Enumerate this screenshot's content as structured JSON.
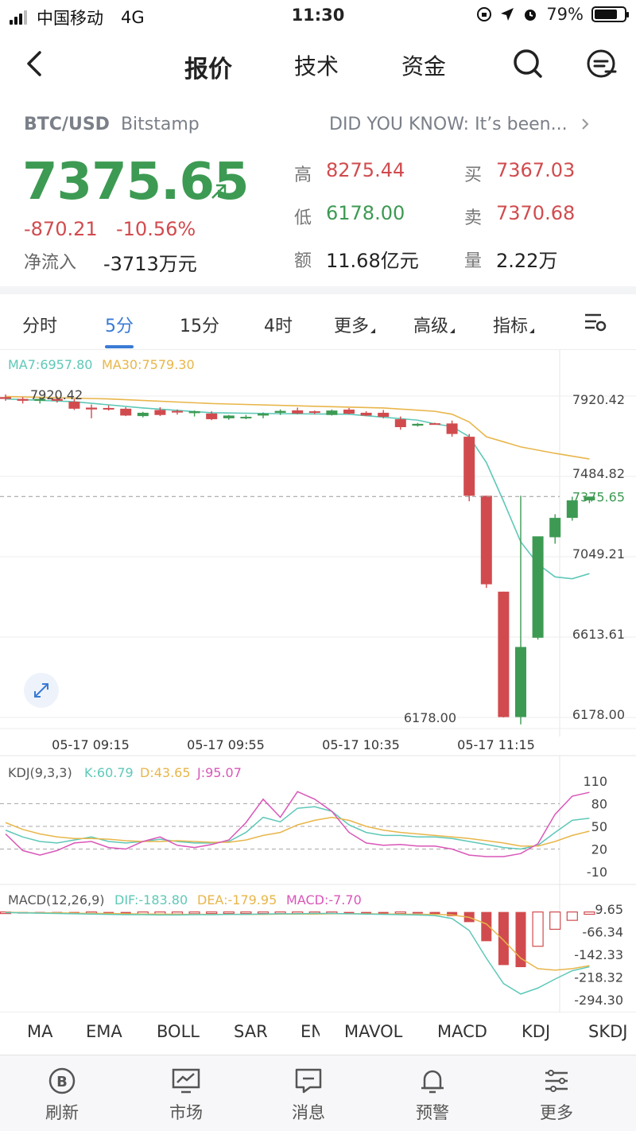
{
  "status_bar": {
    "carrier": "中国移动",
    "network": "4G",
    "time": "11:30",
    "battery": "79%",
    "battery_level": 0.79
  },
  "nav": {
    "tabs": [
      "报价",
      "技术",
      "资金"
    ],
    "active_tab": "报价"
  },
  "quote": {
    "pair": "BTC/USD",
    "exchange": "Bitstamp",
    "news": "DID YOU KNOW: It’s been...",
    "price": "7375.65",
    "change": "-870.21",
    "change_pct": "-10.56%",
    "net_flow_label": "净流入",
    "net_flow": "-3713万元",
    "high_label": "高",
    "high": "8275.44",
    "low_label": "低",
    "low": "6178.00",
    "amount_label": "额",
    "amount": "11.68亿元",
    "bid_label": "买",
    "bid": "7367.03",
    "ask_label": "卖",
    "ask": "7370.68",
    "volume_label": "量",
    "volume": "2.22万"
  },
  "periods": [
    "分时",
    "5分",
    "15分",
    "4时",
    "更多",
    "高级",
    "指标"
  ],
  "active_period": "5分",
  "colors": {
    "up": "#3d9a53",
    "down": "#d14b4e",
    "ma7": "#5ec8b8",
    "ma30": "#e8b64a",
    "k": "#5ec8b8",
    "d": "#e8b64a",
    "j": "#d956b8",
    "accent": "#3a7bd5"
  },
  "chart_data": [
    {
      "type": "candlestick",
      "legend": {
        "ma7": "MA7:6957.80",
        "ma30": "MA30:7579.30"
      },
      "y_ticks": [
        "7920.42",
        "7484.82",
        "7049.21",
        "6613.61",
        "6178.00"
      ],
      "y_range": [
        6178.0,
        7920.42
      ],
      "last_price": "7375.65",
      "max_label": "7920.42",
      "min_label": "6178.00",
      "x_labels": [
        "05-17 09:15",
        "05-17 09:55",
        "05-17 10:35",
        "05-17 11:15"
      ],
      "candles": [
        [
          7915,
          7930,
          7895,
          7905
        ],
        [
          7905,
          7915,
          7880,
          7895
        ],
        [
          7895,
          7915,
          7880,
          7905
        ],
        [
          7905,
          7918,
          7885,
          7895
        ],
        [
          7890,
          7905,
          7845,
          7852
        ],
        [
          7858,
          7875,
          7800,
          7848
        ],
        [
          7856,
          7870,
          7842,
          7850
        ],
        [
          7852,
          7860,
          7812,
          7815
        ],
        [
          7812,
          7835,
          7805,
          7830
        ],
        [
          7845,
          7860,
          7812,
          7818
        ],
        [
          7840,
          7848,
          7820,
          7832
        ],
        [
          7828,
          7842,
          7810,
          7838
        ],
        [
          7826,
          7838,
          7790,
          7795
        ],
        [
          7800,
          7818,
          7792,
          7815
        ],
        [
          7805,
          7818,
          7795,
          7808
        ],
        [
          7815,
          7832,
          7800,
          7826
        ],
        [
          7830,
          7848,
          7818,
          7840
        ],
        [
          7843,
          7858,
          7822,
          7826
        ],
        [
          7838,
          7842,
          7822,
          7830
        ],
        [
          7818,
          7848,
          7815,
          7842
        ],
        [
          7847,
          7856,
          7822,
          7825
        ],
        [
          7830,
          7838,
          7812,
          7815
        ],
        [
          7830,
          7845,
          7800,
          7808
        ],
        [
          7795,
          7810,
          7738,
          7752
        ],
        [
          7760,
          7775,
          7755,
          7770
        ],
        [
          7773,
          7776,
          7766,
          7772
        ],
        [
          7772,
          7788,
          7700,
          7715
        ],
        [
          7700,
          7715,
          7350,
          7380
        ],
        [
          7380,
          7380,
          6880,
          6900
        ],
        [
          6860,
          6860,
          6178,
          6180
        ],
        [
          6180,
          7380,
          6140,
          6560
        ],
        [
          6610,
          7140,
          6600,
          7160
        ],
        [
          7155,
          7280,
          7120,
          7260
        ],
        [
          7260,
          7375,
          7245,
          7355
        ],
        [
          7355,
          7375,
          7340,
          7375.65
        ]
      ],
      "ma7_points": [
        [
          0,
          7905
        ],
        [
          4,
          7890
        ],
        [
          8,
          7856
        ],
        [
          12,
          7830
        ],
        [
          16,
          7825
        ],
        [
          20,
          7822
        ],
        [
          24,
          7790
        ],
        [
          25,
          7770
        ],
        [
          26,
          7755
        ],
        [
          27,
          7700
        ],
        [
          28,
          7560
        ],
        [
          29,
          7350
        ],
        [
          30,
          7130
        ],
        [
          31,
          7010
        ],
        [
          32,
          6940
        ],
        [
          33,
          6930
        ],
        [
          34,
          6957.8
        ]
      ],
      "ma30_points": [
        [
          0,
          7918
        ],
        [
          6,
          7905
        ],
        [
          12,
          7880
        ],
        [
          18,
          7865
        ],
        [
          22,
          7856
        ],
        [
          25,
          7838
        ],
        [
          26,
          7822
        ],
        [
          27,
          7780
        ],
        [
          28,
          7700
        ],
        [
          30,
          7645
        ],
        [
          32,
          7610
        ],
        [
          34,
          7579.3
        ]
      ]
    },
    {
      "type": "line",
      "title": "KDJ(9,3,3)",
      "legend": {
        "k": "K:60.79",
        "d": "D:43.65",
        "j": "J:95.07"
      },
      "y_ticks": [
        "110",
        "80",
        "50",
        "20",
        "-10"
      ],
      "y_range": [
        -10,
        110
      ],
      "series": [
        {
          "name": "K",
          "values": [
            45,
            36,
            30,
            28,
            32,
            36,
            30,
            28,
            30,
            33,
            30,
            28,
            28,
            30,
            42,
            62,
            56,
            74,
            76,
            70,
            52,
            42,
            38,
            38,
            36,
            36,
            34,
            30,
            26,
            22,
            20,
            25,
            42,
            58,
            60.79
          ]
        },
        {
          "name": "D",
          "values": [
            55,
            46,
            40,
            36,
            34,
            34,
            33,
            31,
            30,
            30,
            31,
            30,
            29,
            29,
            32,
            38,
            42,
            52,
            58,
            62,
            58,
            50,
            45,
            42,
            40,
            38,
            36,
            34,
            31,
            28,
            24,
            24,
            30,
            38,
            43.65
          ]
        },
        {
          "name": "J",
          "values": [
            40,
            18,
            12,
            18,
            28,
            30,
            22,
            20,
            30,
            36,
            25,
            22,
            26,
            32,
            55,
            86,
            62,
            96,
            86,
            70,
            42,
            28,
            25,
            26,
            24,
            24,
            20,
            12,
            10,
            10,
            14,
            27,
            66,
            90,
            95.07
          ]
        }
      ]
    },
    {
      "type": "bar",
      "title": "MACD(12,26,9)",
      "legend": {
        "dif": "DIF:-183.80",
        "dea": "DEA:-179.95",
        "macd": "MACD:-7.70"
      },
      "y_ticks": [
        "9.65",
        "-66.34",
        "-142.33",
        "-218.32",
        "-294.30"
      ],
      "y_range": [
        -294.3,
        9.65
      ],
      "histogram": [
        -2,
        -3,
        -4,
        -5,
        -6,
        -6,
        -7,
        -8,
        -8,
        -7,
        -7,
        -6,
        -5,
        -5,
        -4,
        -3,
        -2,
        -1,
        -1,
        0,
        -2,
        -3,
        -4,
        -4,
        -5,
        -7,
        -14,
        -34,
        -98,
        -178,
        -185,
        -115,
        -58,
        -28,
        -7.7
      ],
      "dif": [
        -2,
        -3,
        -4,
        -5,
        -6,
        -7,
        -8,
        -9,
        -9,
        -10,
        -10,
        -9,
        -9,
        -8,
        -8,
        -7,
        -6,
        -6,
        -5,
        -5,
        -6,
        -7,
        -8,
        -9,
        -10,
        -12,
        -22,
        -62,
        -155,
        -240,
        -275,
        -255,
        -225,
        -197,
        -183.8
      ],
      "dea": [
        -1,
        -2,
        -3,
        -3,
        -4,
        -5,
        -5,
        -6,
        -7,
        -7,
        -8,
        -8,
        -8,
        -8,
        -8,
        -8,
        -7,
        -7,
        -7,
        -6,
        -6,
        -6,
        -7,
        -7,
        -8,
        -8,
        -10,
        -18,
        -40,
        -95,
        -155,
        -190,
        -195,
        -190,
        -179.95
      ]
    }
  ],
  "indicators": [
    "MA",
    "EMA",
    "BOLL",
    "SAR",
    "EN",
    "MAVOL",
    "MACD",
    "KDJ",
    "SKDJ"
  ],
  "active_indicators": [
    "MA",
    "MACD",
    "KDJ"
  ],
  "tabbar": [
    "刷新",
    "市场",
    "消息",
    "预警",
    "更多"
  ]
}
